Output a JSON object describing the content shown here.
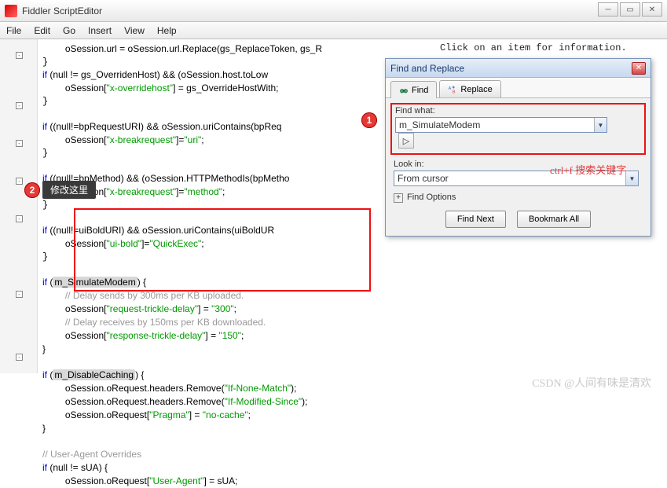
{
  "window": {
    "title": "Fiddler ScriptEditor"
  },
  "menu": {
    "file": "File",
    "edit": "Edit",
    "go": "Go",
    "insert": "Insert",
    "view": "View",
    "help": "Help"
  },
  "info_hint": "Click on an item for information.",
  "code": {
    "l1a": "oSession.url = oSession.url.Replace(gs_ReplaceToken, gs_R",
    "l2a": "if",
    "l2b": " (null != gs_OverridenHost) && (oSession.host.toLow",
    "l3a": "oSession[",
    "l3b": "\"x-overridehost\"",
    "l3c": "] = gs_OverrideHostWith;",
    "l5a": "if",
    "l5b": " ((null!=bpRequestURI) && oSession.uriContains(bpReq",
    "l6a": "oSession[",
    "l6b": "\"x-breakrequest\"",
    "l6c": "]=",
    "l6d": "\"uri\"",
    "l6e": ";",
    "l8a": "if",
    "l8b": " ((null!=bpMethod) && (oSession.HTTPMethodIs(bpMetho",
    "l9a": "oSession[",
    "l9b": "\"x-breakrequest\"",
    "l9c": "]=",
    "l9d": "\"method\"",
    "l9e": ";",
    "l11a": "if",
    "l11b": " ((null!=uiBoldURI) && oSession.uriContains(uiBoldUR",
    "l12a": "oSession[",
    "l12b": "\"ui-bold\"",
    "l12c": "]=",
    "l12d": "\"QuickExec\"",
    "l12e": ";",
    "l14a": "if",
    "l14b": " (",
    "l14c": "m_SimulateModem",
    "l14d": ") {",
    "l15": "// Delay sends by 300ms per KB uploaded.",
    "l16a": "oSession[",
    "l16b": "\"request-trickle-delay\"",
    "l16c": "] = ",
    "l16d": "\"300\"",
    "l16e": ";",
    "l17": "// Delay receives by 150ms per KB downloaded.",
    "l18a": "oSession[",
    "l18b": "\"response-trickle-delay\"",
    "l18c": "] = ",
    "l18d": "\"150\"",
    "l18e": ";",
    "l19": "}",
    "l21a": "if",
    "l21b": " (",
    "l21c": "m_DisableCaching",
    "l21d": ") {",
    "l22a": "oSession.oRequest.headers.Remove(",
    "l22b": "\"If-None-Match\"",
    "l22c": ");",
    "l23a": "oSession.oRequest.headers.Remove(",
    "l23b": "\"If-Modified-Since\"",
    "l23c": ");",
    "l24a": "oSession.oRequest[",
    "l24b": "\"Pragma\"",
    "l24c": "] = ",
    "l24d": "\"no-cache\"",
    "l24e": ";",
    "l25": "}",
    "l27": "// User-Agent Overrides",
    "l28a": "if",
    "l28b": " (null != sUA) {",
    "l29a": "oSession.oRequest[",
    "l29b": "\"User-Agent\"",
    "l29c": "] = sUA;"
  },
  "find": {
    "title": "Find and Replace",
    "tab_find": "Find",
    "tab_replace": "Replace",
    "find_what_label": "Find what:",
    "find_what_value": "m_SimulateModem",
    "look_in_label": "Look in:",
    "look_in_value": "From cursor",
    "options_label": "Find Options",
    "btn_find_next": "Find Next",
    "btn_bookmark": "Bookmark All"
  },
  "annotations": {
    "badge1": "1",
    "badge2": "2",
    "modify_here": "修改这里",
    "ctrlf": "ctrl+f 搜索关键字"
  },
  "watermark": "CSDN @人间有味是清欢"
}
